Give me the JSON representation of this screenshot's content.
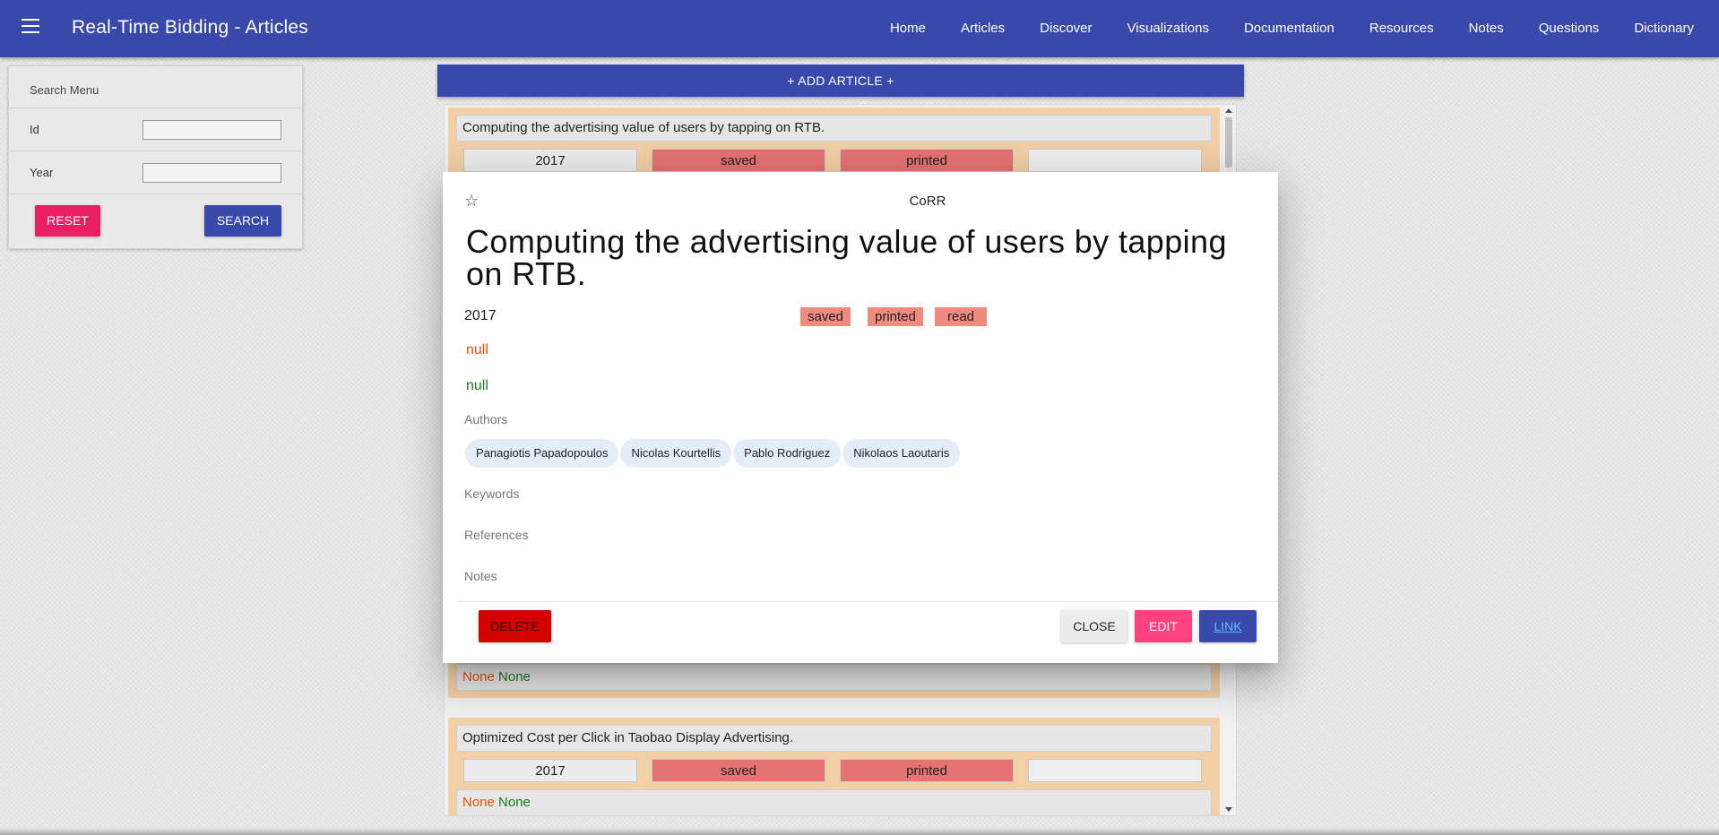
{
  "appbar": {
    "title": "Real-Time Bidding - Articles",
    "nav": [
      "Home",
      "Articles",
      "Discover",
      "Visualizations",
      "Documentation",
      "Resources",
      "Notes",
      "Questions",
      "Dictionary"
    ]
  },
  "search": {
    "title": "Search Menu",
    "fields": [
      {
        "label": "Id",
        "value": ""
      },
      {
        "label": "Year",
        "value": ""
      }
    ],
    "reset_label": "RESET",
    "search_label": "SEARCH"
  },
  "add_article_label": "+ ADD ARTICLE +",
  "articles": [
    {
      "title": "Computing the advertising value of users by tapping on RTB.",
      "year": "2017",
      "status1": "saved",
      "status2": "printed",
      "status3": "",
      "foot_a": "None",
      "foot_b": "None"
    },
    {
      "title": "Optimized Cost per Click in Taobao Display Advertising.",
      "year": "2017",
      "status1": "saved",
      "status2": "printed",
      "status3": "",
      "foot_a": "None",
      "foot_b": "None"
    }
  ],
  "dialog": {
    "star": "☆",
    "journal": "CoRR",
    "title": "Computing the advertising value of users by tapping on RTB.",
    "year": "2017",
    "tags": [
      "saved",
      "printed",
      "read"
    ],
    "null_a": "null",
    "null_b": "null",
    "authors_label": "Authors",
    "authors": [
      "Panagiotis Papadopoulos",
      "Nicolas Kourtellis",
      "Pablo Rodriguez",
      "Nikolaos Laoutaris"
    ],
    "keywords_label": "Keywords",
    "references_label": "References",
    "notes_label": "Notes",
    "delete_label": "DELETE",
    "close_label": "CLOSE",
    "edit_label": "EDIT",
    "link_label": "LINK"
  },
  "colors": {
    "primary": "#3949ab",
    "accent": "#e91e63",
    "danger": "#d50000",
    "status": "#e57373",
    "card_bg": "#f2cfa5"
  }
}
